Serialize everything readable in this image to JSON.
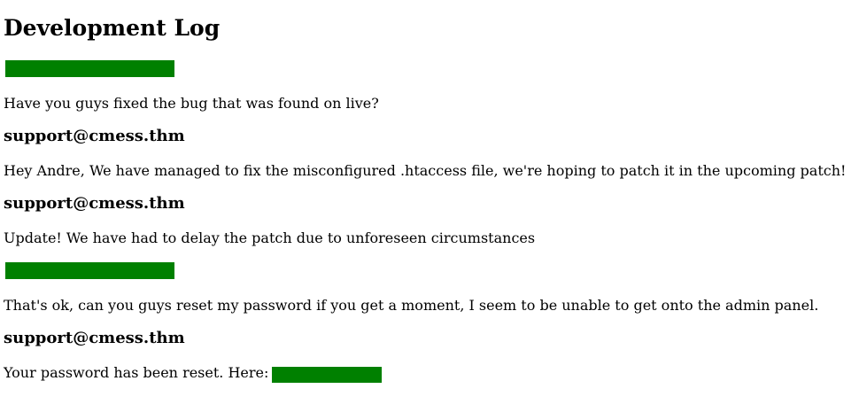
{
  "page": {
    "title": "Development Log"
  },
  "entries": [
    {
      "author": "",
      "author_redacted": true,
      "message": "Have you guys fixed the bug that was found on live?"
    },
    {
      "author": "support@cmess.thm",
      "author_redacted": false,
      "message": "Hey Andre, We have managed to fix the misconfigured .htaccess file, we're hoping to patch it in the upcoming patch!"
    },
    {
      "author": "support@cmess.thm",
      "author_redacted": false,
      "message": "Update! We have had to delay the patch due to unforeseen circumstances"
    },
    {
      "author": "",
      "author_redacted": true,
      "message": "That's ok, can you guys reset my password if you get a moment, I seem to be unable to get onto the admin panel."
    },
    {
      "author": "support@cmess.thm",
      "author_redacted": false,
      "message": "Your password has been reset. Here:"
    }
  ],
  "colors": {
    "redaction": "#008000"
  }
}
